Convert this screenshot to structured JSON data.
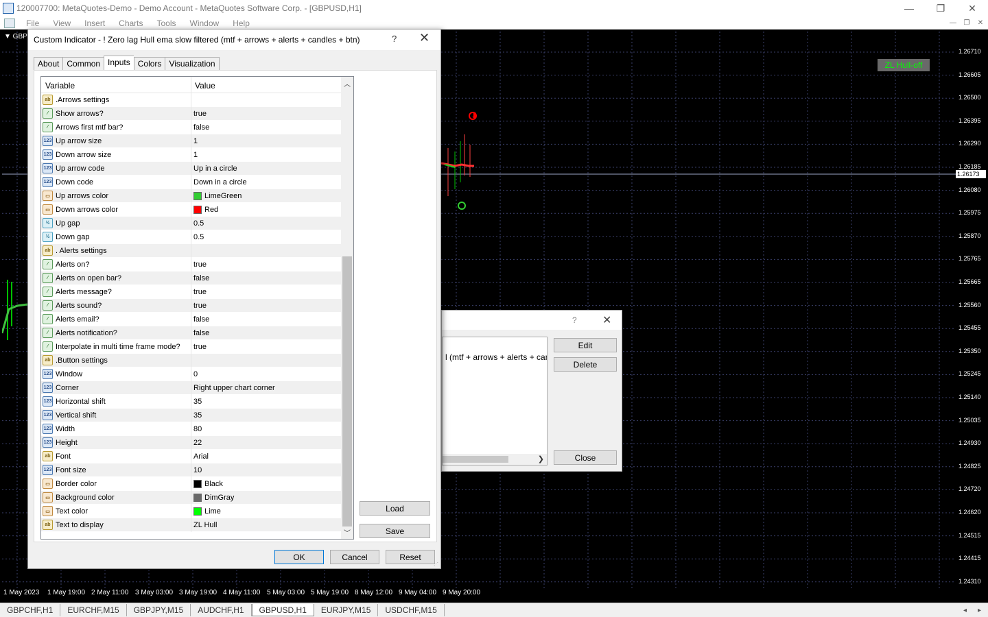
{
  "window": {
    "title": "120007700: MetaQuotes-Demo - Demo Account - MetaQuotes Software Corp. - [GBPUSD,H1]",
    "minimize": "—",
    "maximize": "❐",
    "close": "✕"
  },
  "menu": [
    "File",
    "View",
    "Insert",
    "Charts",
    "Tools",
    "Window",
    "Help"
  ],
  "chart": {
    "symbol_label": "▼ GBP",
    "button_text": "ZL Hull-off",
    "current_price": "1.26173",
    "prices": [
      "1.26710",
      "1.26605",
      "1.26500",
      "1.26395",
      "1.26290",
      "1.26185",
      "1.26080",
      "1.25975",
      "1.25870",
      "1.25765",
      "1.25665",
      "1.25560",
      "1.25455",
      "1.25350",
      "1.25245",
      "1.25140",
      "1.25035",
      "1.24930",
      "1.24825",
      "1.24720",
      "1.24620",
      "1.24515",
      "1.24415",
      "1.24310"
    ],
    "times": [
      "1 May 2023",
      "1 May 19:00",
      "2 May 11:00",
      "3 May 03:00",
      "3 May 19:00",
      "4 May 11:00",
      "5 May 03:00",
      "5 May 19:00",
      "8 May 12:00",
      "9 May 04:00",
      "9 May 20:00"
    ],
    "colors": {
      "up_arrow": "#32cd32",
      "down_arrow": "#ff0000",
      "button_bg": "#696969",
      "button_text": "#00ff00"
    }
  },
  "symbol_tabs": [
    "GBPCHF,H1",
    "EURCHF,M15",
    "GBPJPY,M15",
    "AUDCHF,H1",
    "GBPUSD,H1",
    "EURJPY,M15",
    "USDCHF,M15"
  ],
  "active_tab": "GBPUSD,H1",
  "indicators_dialog": {
    "help": "?",
    "close_x": "✕",
    "list_item": "l (mtf + arrows + alerts + candl",
    "buttons": {
      "edit": "Edit",
      "delete": "Delete",
      "close": "Close"
    }
  },
  "dialog": {
    "title": "Custom Indicator - ! Zero lag Hull ema slow filtered (mtf + arrows + alerts + candles + btn)",
    "help": "?",
    "close_x": "✕",
    "tabs": [
      "About",
      "Common",
      "Inputs",
      "Colors",
      "Visualization"
    ],
    "active_tab": "Inputs",
    "columns": {
      "variable": "Variable",
      "value": "Value"
    },
    "rows": [
      {
        "type": "str",
        "var": ".Arrows settings",
        "val": ""
      },
      {
        "type": "bool",
        "var": "Show arrows?",
        "val": "true"
      },
      {
        "type": "bool",
        "var": "Arrows first mtf bar?",
        "val": "false"
      },
      {
        "type": "int",
        "var": "Up arrow size",
        "val": "1"
      },
      {
        "type": "int",
        "var": "Down arrow size",
        "val": "1"
      },
      {
        "type": "int",
        "var": "Up arrow code",
        "val": "Up in a circle"
      },
      {
        "type": "int",
        "var": "Down code",
        "val": "Down in a circle"
      },
      {
        "type": "clr",
        "var": "Up arrows color",
        "val": "LimeGreen",
        "swatch": "#32cd32"
      },
      {
        "type": "clr",
        "var": "Down arrows color",
        "val": "Red",
        "swatch": "#ff0000"
      },
      {
        "type": "dbl",
        "var": "Up gap",
        "val": "0.5"
      },
      {
        "type": "dbl",
        "var": "Down gap",
        "val": "0.5"
      },
      {
        "type": "str",
        "var": ". Alerts settings",
        "val": ""
      },
      {
        "type": "bool",
        "var": "Alerts on?",
        "val": "true"
      },
      {
        "type": "bool",
        "var": "Alerts on open bar?",
        "val": "false"
      },
      {
        "type": "bool",
        "var": "Alerts message?",
        "val": "true"
      },
      {
        "type": "bool",
        "var": "Alerts sound?",
        "val": "true"
      },
      {
        "type": "bool",
        "var": "Alerts email?",
        "val": "false"
      },
      {
        "type": "bool",
        "var": "Alerts notification?",
        "val": "false"
      },
      {
        "type": "bool",
        "var": "Interpolate in multi time frame mode?",
        "val": "true"
      },
      {
        "type": "str",
        "var": ".Button settings",
        "val": ""
      },
      {
        "type": "int",
        "var": "Window",
        "val": "0"
      },
      {
        "type": "int",
        "var": "Corner",
        "val": "Right upper chart corner"
      },
      {
        "type": "int",
        "var": "Horizontal shift",
        "val": "35"
      },
      {
        "type": "int",
        "var": "Vertical shift",
        "val": "35"
      },
      {
        "type": "int",
        "var": "Width",
        "val": "80"
      },
      {
        "type": "int",
        "var": "Height",
        "val": "22"
      },
      {
        "type": "str",
        "var": "Font",
        "val": "Arial"
      },
      {
        "type": "int",
        "var": "Font size",
        "val": "10"
      },
      {
        "type": "clr",
        "var": "Border color",
        "val": "Black",
        "swatch": "#000000"
      },
      {
        "type": "clr",
        "var": "Background color",
        "val": "DimGray",
        "swatch": "#696969"
      },
      {
        "type": "clr",
        "var": "Text color",
        "val": "Lime",
        "swatch": "#00ff00"
      },
      {
        "type": "str",
        "var": "Text to display",
        "val": "ZL Hull"
      }
    ],
    "buttons": {
      "load": "Load",
      "save": "Save",
      "ok": "OK",
      "cancel": "Cancel",
      "reset": "Reset"
    }
  }
}
